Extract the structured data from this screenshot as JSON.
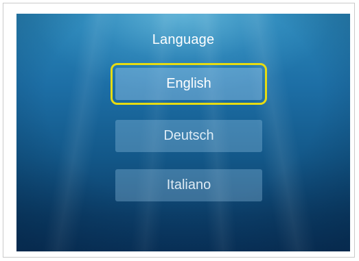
{
  "menu": {
    "title": "Language",
    "options": [
      {
        "label": "English",
        "selected": true
      },
      {
        "label": "Deutsch",
        "selected": false
      },
      {
        "label": "Italiano",
        "selected": false
      }
    ],
    "highlight_color": "#e7dc12"
  }
}
